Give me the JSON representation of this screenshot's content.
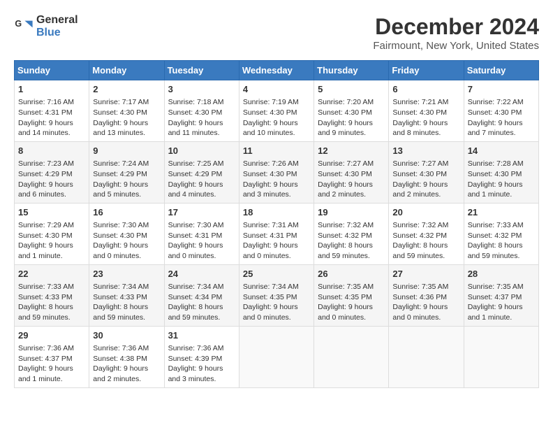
{
  "header": {
    "logo_line1": "General",
    "logo_line2": "Blue",
    "title": "December 2024",
    "subtitle": "Fairmount, New York, United States"
  },
  "weekdays": [
    "Sunday",
    "Monday",
    "Tuesday",
    "Wednesday",
    "Thursday",
    "Friday",
    "Saturday"
  ],
  "weeks": [
    [
      {
        "day": "1",
        "sunrise": "7:16 AM",
        "sunset": "4:31 PM",
        "daylight": "9 hours and 14 minutes."
      },
      {
        "day": "2",
        "sunrise": "7:17 AM",
        "sunset": "4:30 PM",
        "daylight": "9 hours and 13 minutes."
      },
      {
        "day": "3",
        "sunrise": "7:18 AM",
        "sunset": "4:30 PM",
        "daylight": "9 hours and 11 minutes."
      },
      {
        "day": "4",
        "sunrise": "7:19 AM",
        "sunset": "4:30 PM",
        "daylight": "9 hours and 10 minutes."
      },
      {
        "day": "5",
        "sunrise": "7:20 AM",
        "sunset": "4:30 PM",
        "daylight": "9 hours and 9 minutes."
      },
      {
        "day": "6",
        "sunrise": "7:21 AM",
        "sunset": "4:30 PM",
        "daylight": "9 hours and 8 minutes."
      },
      {
        "day": "7",
        "sunrise": "7:22 AM",
        "sunset": "4:30 PM",
        "daylight": "9 hours and 7 minutes."
      }
    ],
    [
      {
        "day": "8",
        "sunrise": "7:23 AM",
        "sunset": "4:29 PM",
        "daylight": "9 hours and 6 minutes."
      },
      {
        "day": "9",
        "sunrise": "7:24 AM",
        "sunset": "4:29 PM",
        "daylight": "9 hours and 5 minutes."
      },
      {
        "day": "10",
        "sunrise": "7:25 AM",
        "sunset": "4:29 PM",
        "daylight": "9 hours and 4 minutes."
      },
      {
        "day": "11",
        "sunrise": "7:26 AM",
        "sunset": "4:30 PM",
        "daylight": "9 hours and 3 minutes."
      },
      {
        "day": "12",
        "sunrise": "7:27 AM",
        "sunset": "4:30 PM",
        "daylight": "9 hours and 2 minutes."
      },
      {
        "day": "13",
        "sunrise": "7:27 AM",
        "sunset": "4:30 PM",
        "daylight": "9 hours and 2 minutes."
      },
      {
        "day": "14",
        "sunrise": "7:28 AM",
        "sunset": "4:30 PM",
        "daylight": "9 hours and 1 minute."
      }
    ],
    [
      {
        "day": "15",
        "sunrise": "7:29 AM",
        "sunset": "4:30 PM",
        "daylight": "9 hours and 1 minute."
      },
      {
        "day": "16",
        "sunrise": "7:30 AM",
        "sunset": "4:30 PM",
        "daylight": "9 hours and 0 minutes."
      },
      {
        "day": "17",
        "sunrise": "7:30 AM",
        "sunset": "4:31 PM",
        "daylight": "9 hours and 0 minutes."
      },
      {
        "day": "18",
        "sunrise": "7:31 AM",
        "sunset": "4:31 PM",
        "daylight": "9 hours and 0 minutes."
      },
      {
        "day": "19",
        "sunrise": "7:32 AM",
        "sunset": "4:32 PM",
        "daylight": "8 hours and 59 minutes."
      },
      {
        "day": "20",
        "sunrise": "7:32 AM",
        "sunset": "4:32 PM",
        "daylight": "8 hours and 59 minutes."
      },
      {
        "day": "21",
        "sunrise": "7:33 AM",
        "sunset": "4:32 PM",
        "daylight": "8 hours and 59 minutes."
      }
    ],
    [
      {
        "day": "22",
        "sunrise": "7:33 AM",
        "sunset": "4:33 PM",
        "daylight": "8 hours and 59 minutes."
      },
      {
        "day": "23",
        "sunrise": "7:34 AM",
        "sunset": "4:33 PM",
        "daylight": "8 hours and 59 minutes."
      },
      {
        "day": "24",
        "sunrise": "7:34 AM",
        "sunset": "4:34 PM",
        "daylight": "8 hours and 59 minutes."
      },
      {
        "day": "25",
        "sunrise": "7:34 AM",
        "sunset": "4:35 PM",
        "daylight": "9 hours and 0 minutes."
      },
      {
        "day": "26",
        "sunrise": "7:35 AM",
        "sunset": "4:35 PM",
        "daylight": "9 hours and 0 minutes."
      },
      {
        "day": "27",
        "sunrise": "7:35 AM",
        "sunset": "4:36 PM",
        "daylight": "9 hours and 0 minutes."
      },
      {
        "day": "28",
        "sunrise": "7:35 AM",
        "sunset": "4:37 PM",
        "daylight": "9 hours and 1 minute."
      }
    ],
    [
      {
        "day": "29",
        "sunrise": "7:36 AM",
        "sunset": "4:37 PM",
        "daylight": "9 hours and 1 minute."
      },
      {
        "day": "30",
        "sunrise": "7:36 AM",
        "sunset": "4:38 PM",
        "daylight": "9 hours and 2 minutes."
      },
      {
        "day": "31",
        "sunrise": "7:36 AM",
        "sunset": "4:39 PM",
        "daylight": "9 hours and 3 minutes."
      },
      null,
      null,
      null,
      null
    ]
  ]
}
